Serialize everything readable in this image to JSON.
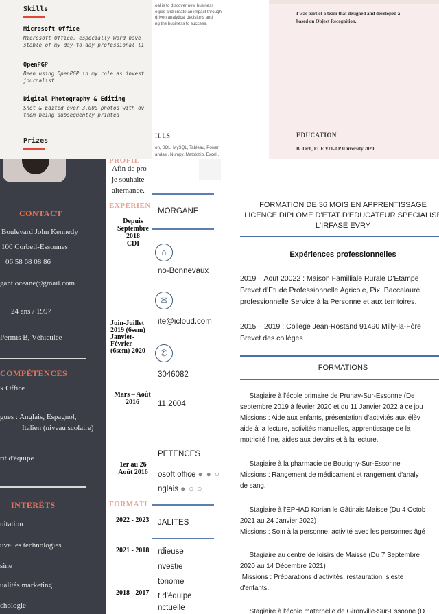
{
  "skills_doc": {
    "heading": "Skills",
    "items": [
      {
        "title": "Microsoft Office",
        "desc": "Microsoft Office, especially Word have\nstable of my day-to-day professional li"
      },
      {
        "title": "OpenPGP",
        "desc": "Been using OpenPGP in my role as invest\njournalist"
      },
      {
        "title": "Digital Photography & Editing",
        "desc": "Shot & Edited over 3.000 photos with ov\nthem being subsequently printed"
      }
    ],
    "prizes_heading": "Prizes"
  },
  "middle_doc": {
    "lines": [
      "oal is to discover new business",
      "egies and create an impact through",
      "driven analytical decisions and",
      "ng the business to success."
    ],
    "skills_heading": "ILLS",
    "skills_lines": [
      "on, SQL, MySQL, Tableau, Power",
      "andas , Numpy, Matplotlib, Excel ,"
    ]
  },
  "pink_doc": {
    "project_lines": [
      "I was part of a team that designed and developed a",
      "based on Object Recognition."
    ],
    "education_heading": "EDUCATION",
    "degree": "B. Tech, ECE VIT-AP University 2020"
  },
  "sidebar": {
    "contact_heading": "CONTACT",
    "contact_items": [
      "Boulevard John Kennedy",
      "100  Corbeil-Essonnes",
      "06 58 68 08 86",
      "gant.oceane@gmail.com",
      "24 ans / 1997",
      "Permis B, Véhiculée"
    ],
    "competences_heading": "COMPÉTENCES",
    "competences_items": [
      "k Office",
      "gues : Anglais, Espagnol,",
      "Italien (niveau scolaire)",
      "rit d'équipe"
    ],
    "interets_heading": "INTÉRÊTS",
    "interets_items": [
      "uitation",
      "uvelles technologies",
      "sine",
      "ualités marketing",
      "chologie"
    ]
  },
  "mid_white": {
    "lines": [
      "PROFIL",
      "Afin de pro",
      "je souhaite",
      "alternance."
    ],
    "experience_heading": "EXPÉRIEN",
    "date1": "Depuis\nSeptembre\n2018\nCDI",
    "date2": "Juin-Juillet\n2019 (6sem)\nJanvier-\nFévrier\n(6sem) 2020",
    "date3": "Mars – Août\n2016",
    "date4": "1er au 26\nAoût 2016",
    "formation_heading": "FORMATI",
    "years": [
      "2022 - 2023",
      "2021 - 2018",
      "2018 - 2017"
    ]
  },
  "contact_card": {
    "name": "MORGANE",
    "city": "no-Bonnevaux",
    "email": "ite@icloud.com",
    "phone": "3046082",
    "birth": "11.2004",
    "competences_heading": "PETENCES",
    "skill1": "osoft office",
    "skill1_dots": "● ● ○",
    "skill2": "nglais",
    "skill2_dots": "● ○ ○",
    "qualites_heading": "JALITES",
    "qualites": [
      "rdieuse",
      "nvestie",
      "tonome",
      "t d'équipe",
      "nctuelle"
    ]
  },
  "main_doc": {
    "title_lines": [
      "FORMATION DE 36 MOIS EN APPRENTISSAGE",
      "LICENCE DIPLOME D'ETAT D'EDUCATEUR SPECIALISE",
      "L'IRFASE EVRY"
    ],
    "experience_heading": "Expériences professionnelles",
    "exp1": "2019 – Aout 20022 : Maison Familliale Rurale D'Etampe\nBrevet d'Etude Professionnelle Agricole, Pix, Baccalauré\nprofessionnelle Service à la Personne et aux territoires.",
    "exp2": "2015 – 2019 : Collège Jean-Rostand 91490 Milly-la-Fôre\nBrevet des collèges",
    "formations_heading": "FORMATIONS",
    "stage1": "     Stagiaire à l'école primaire de Prunay-Sur-Essonne (De\nseptembre 2019 à février 2020 et du 11 Janvier 2022 à ce jou\nMissions : Aide aux enfants, présentation d'activités aux élèv\naide à la lecture, activités manuelles, apprentissage de la\nmotricité fine, aides aux devoirs et à la lecture.",
    "stage2": "     Stagiaire à la pharmacie de Boutigny-Sur-Essonne\nMissions : Rangement de médicament et rangement d'analy\nde sang.",
    "stage3": "     Stagiaire à l'EPHAD Korian le Gâtinais Maisse (Du 4 Octob\n2021 au 24 Janvier 2022)\nMissions : Soin à la personne, activité avec les personnes âgé",
    "stage4": "     Stagiaire au centre de loisirs de Maisse (Du 7 Septembre\n2020 au 14 Décembre 2021)\n Missions : Préparations d'activités, restauration, sieste\nd'enfants.",
    "stage5": "     Stagiaire à l'école maternelle de Gironville-Sur-Essonne (D"
  }
}
